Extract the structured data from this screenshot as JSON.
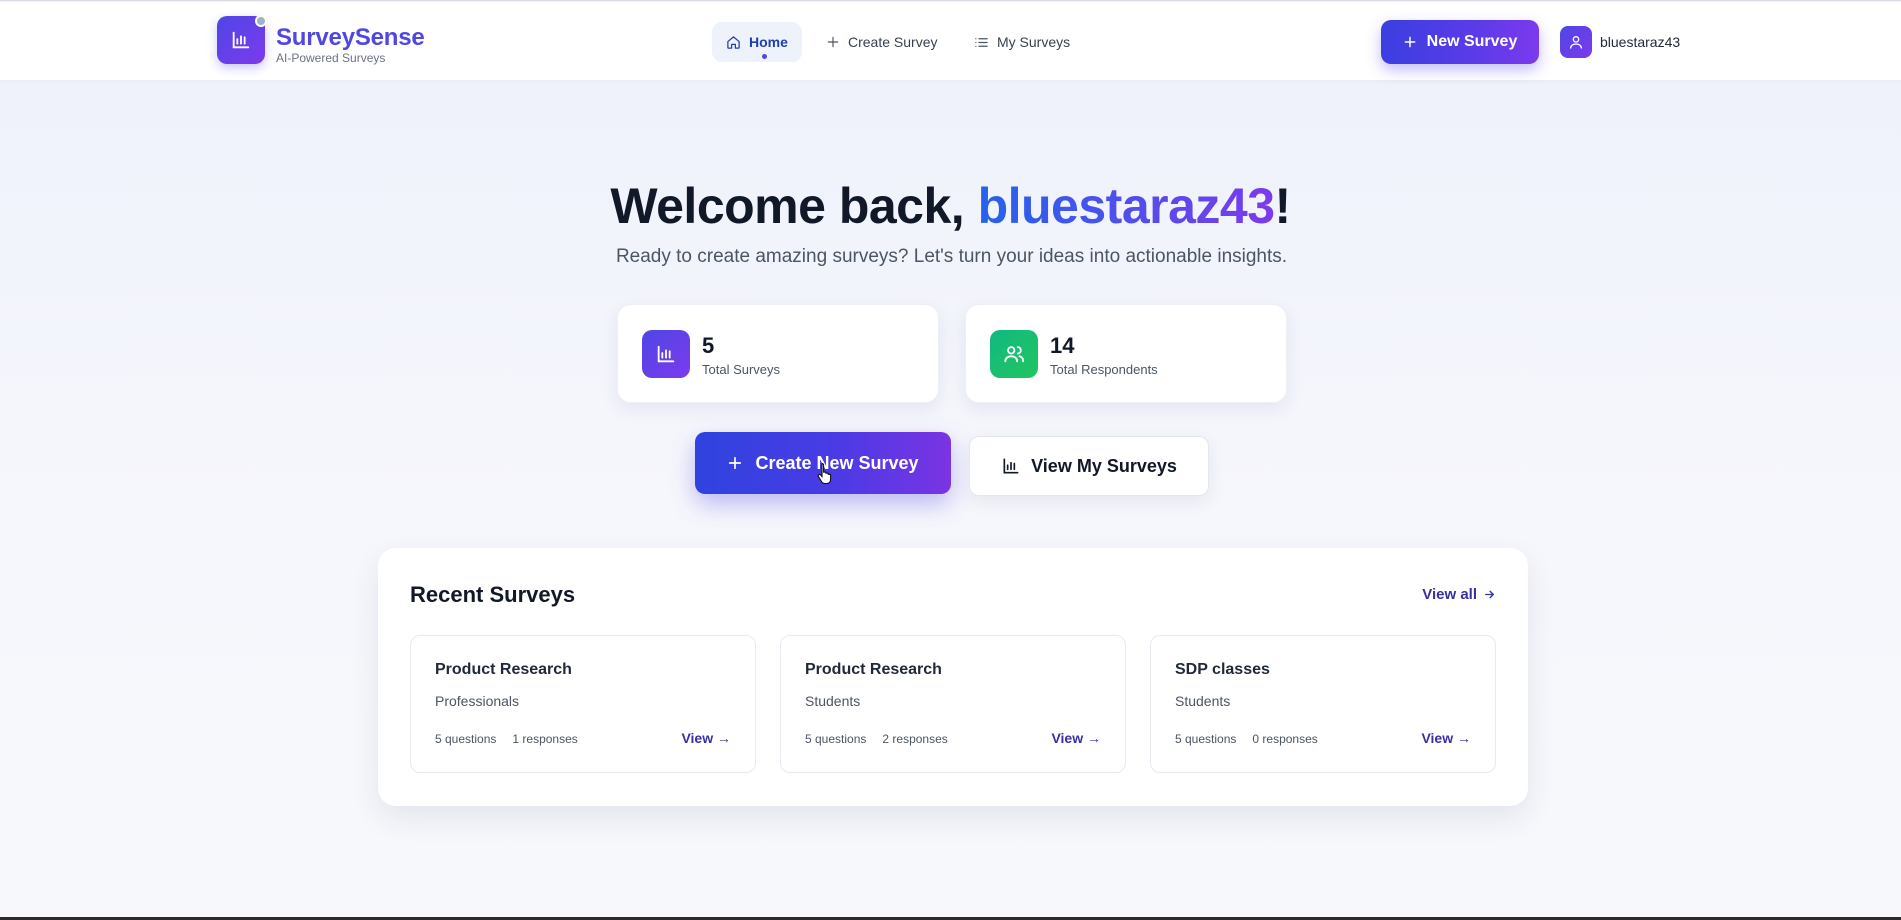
{
  "header": {
    "brand_name": "SurveySense",
    "brand_tagline": "AI-Powered Surveys",
    "nav": [
      {
        "label": "Home",
        "icon": "home-icon",
        "active": true
      },
      {
        "label": "Create Survey",
        "icon": "plus-icon",
        "active": false
      },
      {
        "label": "My Surveys",
        "icon": "list-icon",
        "active": false
      }
    ],
    "new_survey_label": "New Survey",
    "username": "bluestaraz43"
  },
  "hero": {
    "greeting": "Welcome back, ",
    "username": "bluestaraz43",
    "exclamation": "!",
    "tagline": "Ready to create amazing surveys? Let's turn your ideas into actionable insights."
  },
  "stats": [
    {
      "value": "5",
      "label": "Total Surveys",
      "icon": "bar-chart-icon",
      "color": "#4f46e5"
    },
    {
      "value": "14",
      "label": "Total Respondents",
      "icon": "users-icon",
      "color": "#10b981"
    }
  ],
  "actions": {
    "primary_label": "Create New Survey",
    "secondary_label": "View My Surveys"
  },
  "recent": {
    "title": "Recent Surveys",
    "view_all_label": "View all",
    "surveys": [
      {
        "title": "Product Research",
        "audience": "Professionals",
        "questions": "5 questions",
        "responses": "1 responses",
        "view_label": "View →"
      },
      {
        "title": "Product Research",
        "audience": "Students",
        "questions": "5 questions",
        "responses": "2 responses",
        "view_label": "View →"
      },
      {
        "title": "SDP classes",
        "audience": "Students",
        "questions": "5 questions",
        "responses": "0 responses",
        "view_label": "View →"
      }
    ]
  },
  "colors": {
    "accent": "#4f46e5",
    "accent_secondary": "#7c3aed",
    "success": "#10b981"
  }
}
